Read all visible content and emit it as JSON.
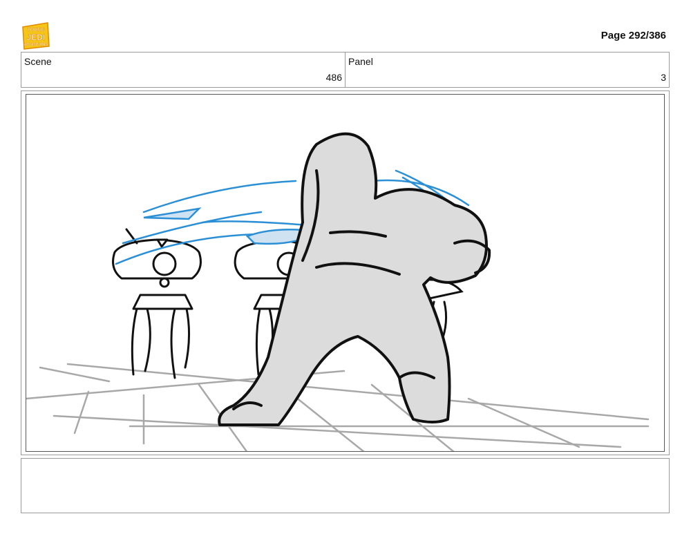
{
  "header": {
    "logo_icon": "young-jedi-adventures-logo",
    "logo_lines": [
      "YOUNG",
      "JEDI",
      "ADVENTURES"
    ],
    "page_label": "Page 292/386"
  },
  "info": {
    "scene_label": "Scene",
    "scene_value": "486",
    "panel_label": "Panel",
    "panel_value": "3"
  },
  "colors": {
    "logo_yellow": "#f5c518",
    "logo_orange": "#e08a00",
    "sketch_ink": "#111111",
    "sketch_fill": "#dcdcdc",
    "floor_grey": "#a8a8a8",
    "motion_blue": "#2b8fd6"
  },
  "notes": {
    "text": ""
  }
}
